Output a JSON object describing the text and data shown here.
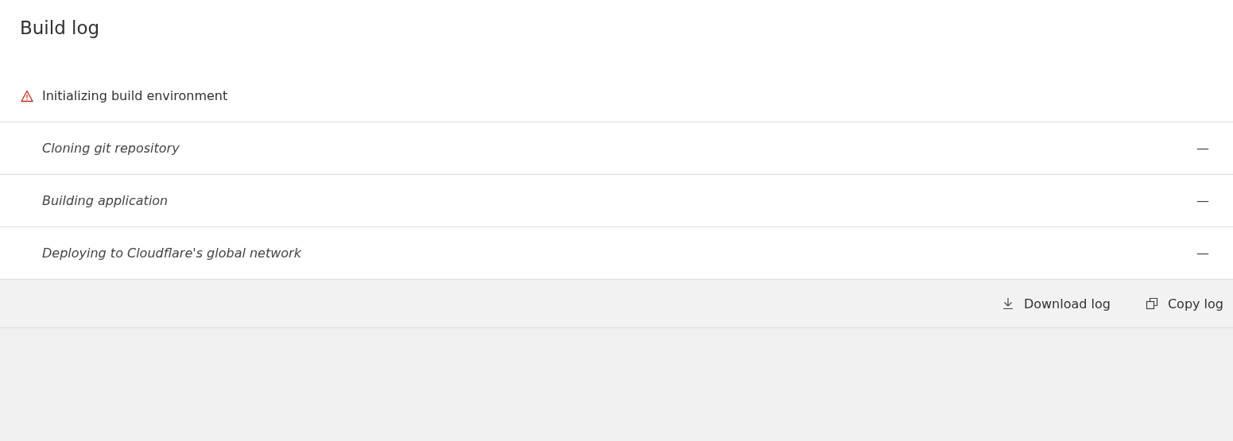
{
  "title": "Build log",
  "steps": [
    {
      "label": "Initializing build environment",
      "kind": "stage",
      "warning": true
    },
    {
      "label": "Cloning git repository",
      "kind": "step",
      "warning": false,
      "duration": "—"
    },
    {
      "label": "Building application",
      "kind": "step",
      "warning": false,
      "duration": "—"
    },
    {
      "label": "Deploying to Cloudflare's global network",
      "kind": "step",
      "warning": false,
      "duration": "—"
    }
  ],
  "actions": [
    {
      "label": "Download log",
      "kind": "download"
    },
    {
      "label": "Copy log",
      "kind": "copy"
    }
  ]
}
